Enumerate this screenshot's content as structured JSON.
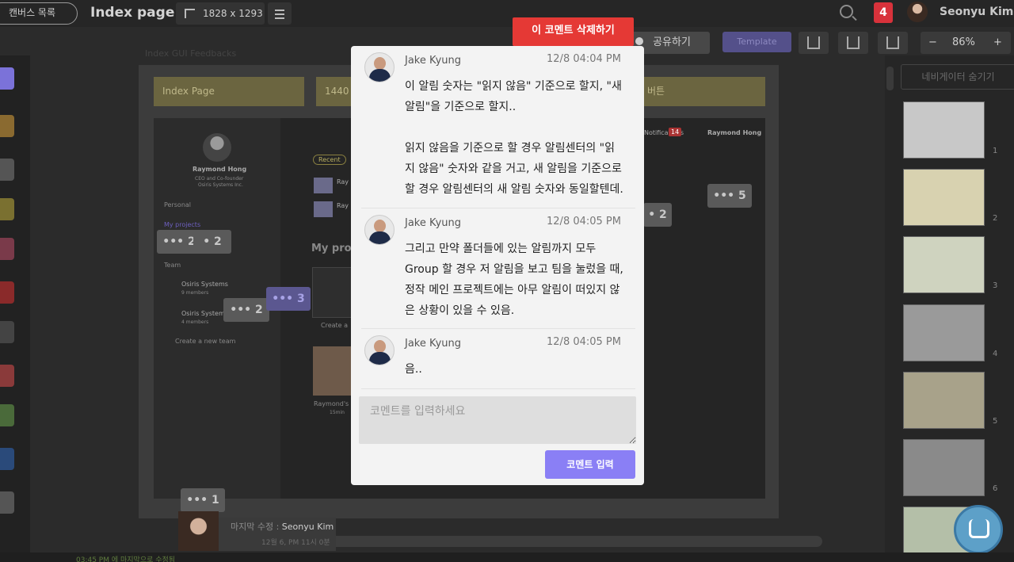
{
  "topbar": {
    "canvas_list": "캔버스 목록",
    "page_title": "Index page",
    "canvas_size": "1828 x 1293",
    "notification_count": "4",
    "user_name": "Seonyu Kim"
  },
  "toolbar": {
    "share_label": "공유하기",
    "template_label": "Template",
    "zoom_minus": "−",
    "zoom_level": "86%",
    "zoom_plus": "+"
  },
  "canvas": {
    "label": "Index GUI Feedbacks",
    "yellow_boxes": [
      "Index Page",
      "1440",
      "버튼"
    ],
    "profile_name": "Raymond Hong",
    "profile_role": "CEO and Co-founder",
    "profile_company": "Osiris Systems Inc.",
    "personal": "Personal",
    "my_projects": "My projects",
    "team": "Team",
    "team1": "Osiris Systems",
    "team1_members": "9 members",
    "team2": "Osiris Systems",
    "team2_members": "4 members",
    "create_team": "Create a new team",
    "recent_tag": "Recent",
    "my_proj_heading": "My pro",
    "ray1": "Ray",
    "ray2": "Ray",
    "notifications": "Notifications",
    "notif_badge": "14",
    "top_right_name": "Raymond Hong",
    "create": "Create a",
    "raymonds": "Raymond's",
    "minutes": "15min",
    "bubbles": [
      "2",
      "2",
      "2",
      "3",
      "5",
      "2",
      "1"
    ]
  },
  "navigator": {
    "hide_label": "네비게이터 숨기기",
    "slides": [
      "1",
      "2",
      "3",
      "4",
      "5",
      "6"
    ]
  },
  "last_edit": {
    "label": "마지막 수정 : ",
    "name": "Seonyu Kim",
    "date": "12월 6, PM 11시 0분"
  },
  "status": {
    "saved": "03:45 PM 에 마지막으로 수정됨"
  },
  "modal": {
    "delete_label": "이 코멘트 삭제하기",
    "comments": [
      {
        "author": "Jake Kyung",
        "time": "12/8 04:04 PM",
        "text": "이 알림 숫자는 \"읽지 않음\" 기준으로 할지, \"새 알림\"을 기준으로 할지..\n\n읽지 않음을 기준으로 할 경우 알림센터의 \"읽지 않음\" 숫자와 같을 거고, 새 알림을 기준으로 할 경우 알림센터의 새 알림 숫자와 동일할텐데."
      },
      {
        "author": "Jake Kyung",
        "time": "12/8 04:05 PM",
        "text": "그리고 만약 폴더들에 있는 알림까지 모두 Group 할 경우 저 알림을 보고 팀을 눌렀을 때, 정작 메인 프로젝트에는 아무 알림이 떠있지 않은 상황이 있을 수 있음."
      },
      {
        "author": "Jake Kyung",
        "time": "12/8 04:05 PM",
        "text": "음.."
      }
    ],
    "input_placeholder": "코멘트를 입력하세요",
    "submit_label": "코멘트 입력"
  },
  "colors": {
    "delete": "#e53935",
    "submit": "#8a7ff5",
    "notification": "#d8323b",
    "template": "#54508a"
  }
}
